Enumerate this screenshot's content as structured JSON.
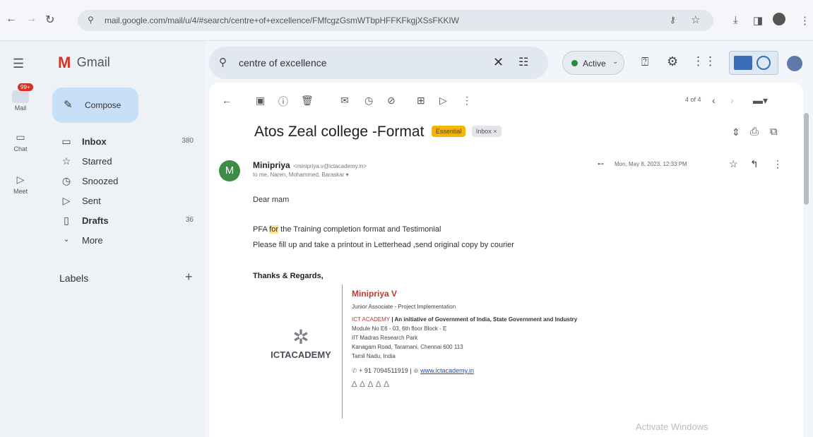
{
  "browser": {
    "url": "mail.google.com/mail/u/4/#search/centre+of+excellence/FMfcgzGsmWTbpHFFKFkgjXSsFKKIW"
  },
  "rail": {
    "mail_badge": "99+",
    "items": [
      {
        "label": "Mail"
      },
      {
        "label": "Chat"
      },
      {
        "label": "Meet"
      }
    ]
  },
  "app": {
    "name": "Gmail"
  },
  "compose_label": "Compose",
  "nav": [
    {
      "label": "Inbox",
      "count": "380",
      "icon": "inbox-icon",
      "bold": true
    },
    {
      "label": "Starred",
      "count": "",
      "icon": "star-icon",
      "bold": false
    },
    {
      "label": "Snoozed",
      "count": "",
      "icon": "clock-icon",
      "bold": false
    },
    {
      "label": "Sent",
      "count": "",
      "icon": "send-icon",
      "bold": false
    },
    {
      "label": "Drafts",
      "count": "36",
      "icon": "draft-icon",
      "bold": true
    },
    {
      "label": "More",
      "count": "",
      "icon": "chevron-down-icon",
      "bold": false
    }
  ],
  "labels_heading": "Labels",
  "search": {
    "value": "centre of excellence"
  },
  "status": {
    "label": "Active"
  },
  "pager": {
    "text": "4 of 4"
  },
  "email": {
    "subject": "Atos Zeal college -Format",
    "tags": [
      "Essential",
      "Inbox ×"
    ],
    "sender_initial": "M",
    "sender_name": "Minipriya",
    "sender_email": "<minipriya.v@ictacademy.in>",
    "recipients": "to me, Naren, Mohammed, Baraskar ▾",
    "date": "Mon, May 8, 2023, 12:33 PM",
    "greeting": "Dear mam",
    "body_line1_pre": "PFA ",
    "body_line1_hl": "for",
    "body_line1_post": " the Training completion format and Testimonial",
    "body_line2": "Please fill up and take  a printout in Letterhead ,send original copy by courier",
    "closing": "Thanks & Regards,"
  },
  "signature": {
    "logo_text": "ICTACADEMY",
    "name": "Minipriya V",
    "title": "Junior Associate - Project Implementation",
    "org_link": "ICT ACADEMY",
    "org_rest": " | An initiative of Government of India, State Government and Industry",
    "address1": "Module No E6 - 03, 6th floor Block - E",
    "address2": "IIT Madras Research Park",
    "address3": "Kanagam Road, Taramani, Chennai 600 113",
    "address4": "Tamil Nadu, India",
    "phone": "+ 91 7094511919 |",
    "website": "www.ictacademy.in"
  },
  "watermark": "Activate Windows",
  "colors": {
    "compose_bg": "#c7e0f8",
    "avatar_green": "#3d8c45",
    "essential_tag": "#f4b400",
    "signature_red": "#c0392b"
  }
}
